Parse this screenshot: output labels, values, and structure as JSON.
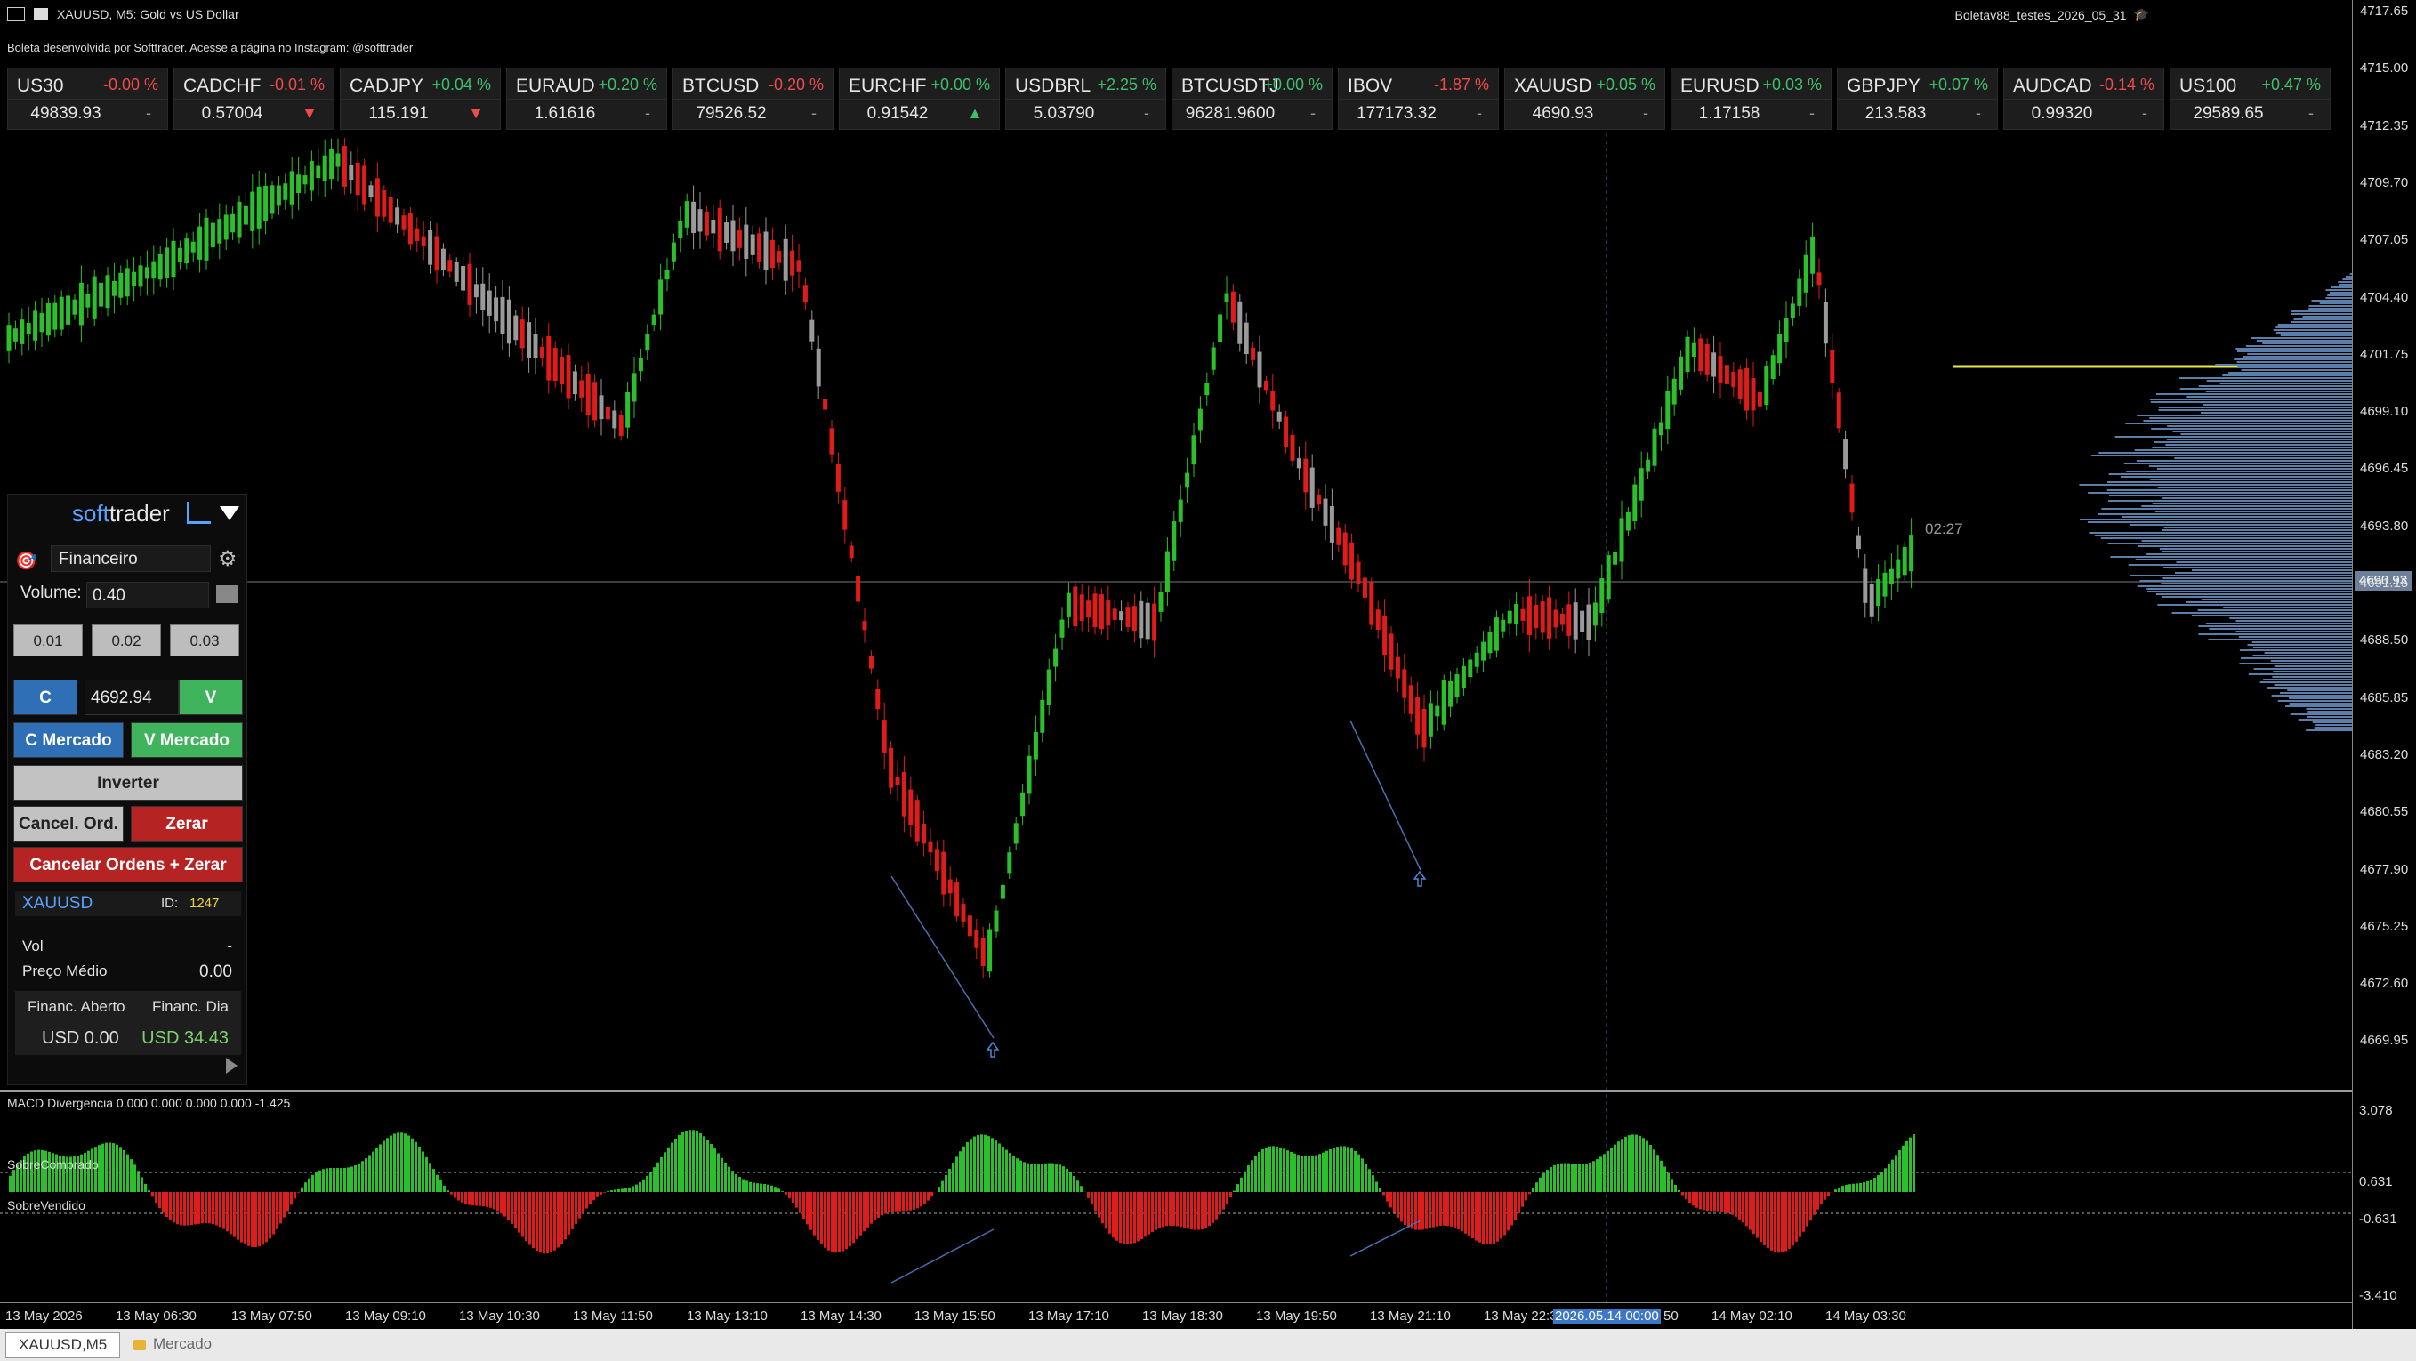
{
  "window": {
    "title": "XAUUSD, M5:  Gold vs US Dollar",
    "right_title": "Boletav88_testes_2026_05_31"
  },
  "info_line": "Boleta desenvolvida por Softtrader. Acesse a página no Instagram: @softtrader",
  "tickers": [
    {
      "symbol": "US30",
      "change": "-0.00 %",
      "price": "49839.93",
      "dir": "-",
      "sign": "neg"
    },
    {
      "symbol": "CADCHF",
      "change": "-0.01 %",
      "price": "0.57004",
      "dir": "▼",
      "sign": "neg"
    },
    {
      "symbol": "CADJPY",
      "change": "+0.04 %",
      "price": "115.191",
      "dir": "▼",
      "sign": "pos"
    },
    {
      "symbol": "EURAUD",
      "change": "+0.20 %",
      "price": "1.61616",
      "dir": "-",
      "sign": "pos"
    },
    {
      "symbol": "BTCUSD",
      "change": "-0.20 %",
      "price": "79526.52",
      "dir": "-",
      "sign": "neg"
    },
    {
      "symbol": "EURCHF",
      "change": "+0.00 %",
      "price": "0.91542",
      "dir": "▲",
      "sign": "pos"
    },
    {
      "symbol": "USDBRL",
      "change": "+2.25 %",
      "price": "5.03790",
      "dir": "-",
      "sign": "pos"
    },
    {
      "symbol": "BTCUSDTJ",
      "change": "+0.00 %",
      "price": "96281.9600",
      "dir": "-",
      "sign": "pos"
    },
    {
      "symbol": "IBOV",
      "change": "-1.87 %",
      "price": "177173.32",
      "dir": "-",
      "sign": "neg"
    },
    {
      "symbol": "XAUUSD",
      "change": "+0.05 %",
      "price": "4690.93",
      "dir": "-",
      "sign": "pos"
    },
    {
      "symbol": "EURUSD",
      "change": "+0.03 %",
      "price": "1.17158",
      "dir": "-",
      "sign": "pos"
    },
    {
      "symbol": "GBPJPY",
      "change": "+0.07 %",
      "price": "213.583",
      "dir": "-",
      "sign": "pos"
    },
    {
      "symbol": "AUDCAD",
      "change": "-0.14 %",
      "price": "0.99320",
      "dir": "-",
      "sign": "neg"
    },
    {
      "symbol": "US100",
      "change": "+0.47 %",
      "price": "29589.65",
      "dir": "-",
      "sign": "pos"
    }
  ],
  "panel": {
    "brand_soft": "soft",
    "brand_trader": "trader",
    "strategy": "Financeiro",
    "volume_label": "Volume:",
    "volume_value": "0.40",
    "quick_volumes": [
      "0.01",
      "0.02",
      "0.03"
    ],
    "buy_label": "C",
    "sell_label": "V",
    "limit_price": "4692.94",
    "buy_market": "C Mercado",
    "sell_market": "V Mercado",
    "invert": "Inverter",
    "cancel_orders": "Cancel. Ord.",
    "zero": "Zerar",
    "cancel_and_zero": "Cancelar Ordens + Zerar",
    "symbol": "XAUUSD",
    "id_label": "ID:",
    "id_value": "1247",
    "vol_label": "Vol",
    "vol_value": "-",
    "avg_price_label": "Preço Médio",
    "avg_price_value": "0.00",
    "fin_open_label": "Financ. Aberto",
    "fin_day_label": "Financ. Dia",
    "fin_open_value": "USD 0.00",
    "fin_day_value": "USD 34.43"
  },
  "chart": {
    "bar_timer": "02:27",
    "current_price": "4690.93",
    "price_ticks": [
      "4717.65",
      "4715.00",
      "4712.35",
      "4709.70",
      "4707.05",
      "4704.40",
      "4701.75",
      "4699.10",
      "4696.45",
      "4693.80",
      "4691.15",
      "4688.50",
      "4685.85",
      "4683.20",
      "4680.55",
      "4677.90",
      "4675.25",
      "4672.60",
      "4669.95"
    ],
    "time_ticks": [
      "13 May 2026",
      "13 May 06:30",
      "13 May 07:50",
      "13 May 09:10",
      "13 May 10:30",
      "13 May 11:50",
      "13 May 13:10",
      "13 May 14:30",
      "13 May 15:50",
      "13 May 17:10",
      "13 May 18:30",
      "13 May 19:50",
      "13 May 21:10",
      "13 May 22:3",
      "2026.05.14 00:00",
      "50",
      "14 May 02:10",
      "14 May 03:30"
    ],
    "macd_label": "MACD Divergencia 0.000 0.000 0.000 0.000 -1.425",
    "overbought_label": "SobreComprado",
    "oversold_label": "SobreVendido",
    "macd_ticks": [
      "3.078",
      "0.631",
      "-0.631",
      "-3.410"
    ]
  },
  "tabs": [
    "XAUUSD,M5",
    "Mercado"
  ],
  "colors": {
    "bull": "#2bbf2b",
    "bear": "#e01b1b",
    "neutral": "#9a9a9a",
    "profile": "#5b7fa8",
    "poc": "#e9e94a"
  }
}
